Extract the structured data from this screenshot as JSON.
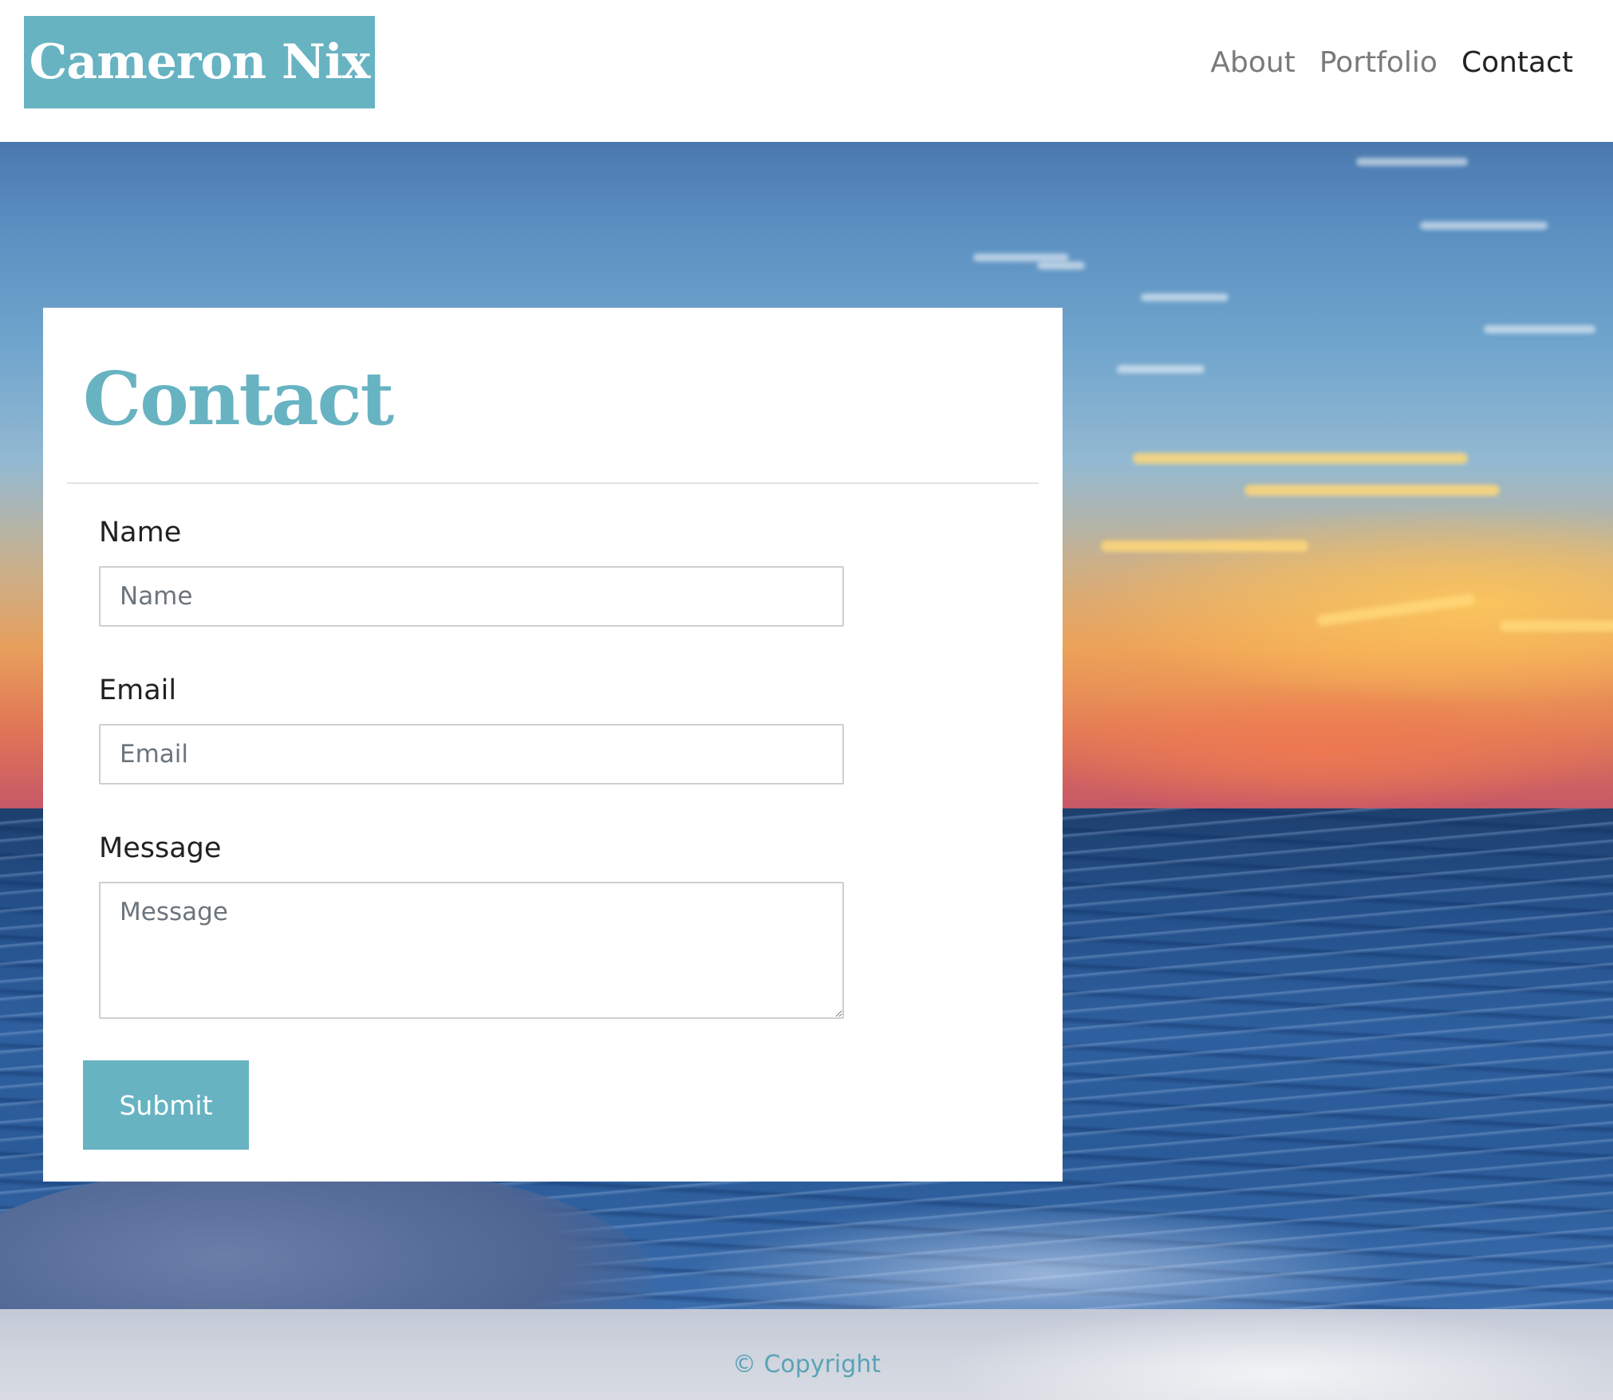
{
  "header": {
    "brand": "Cameron Nix",
    "nav": [
      {
        "label": "About",
        "active": false
      },
      {
        "label": "Portfolio",
        "active": false
      },
      {
        "label": "Contact",
        "active": true
      }
    ]
  },
  "contact": {
    "title": "Contact",
    "fields": {
      "name": {
        "label": "Name",
        "placeholder": "Name",
        "value": ""
      },
      "email": {
        "label": "Email",
        "placeholder": "Email",
        "value": ""
      },
      "message": {
        "label": "Message",
        "placeholder": "Message",
        "value": ""
      }
    },
    "submit_label": "Submit"
  },
  "footer": {
    "text": "© Copyright"
  },
  "colors": {
    "accent": "#67b3c2",
    "nav_text": "#7a7a7a",
    "nav_active": "#212121",
    "card_bg": "#ffffff"
  }
}
